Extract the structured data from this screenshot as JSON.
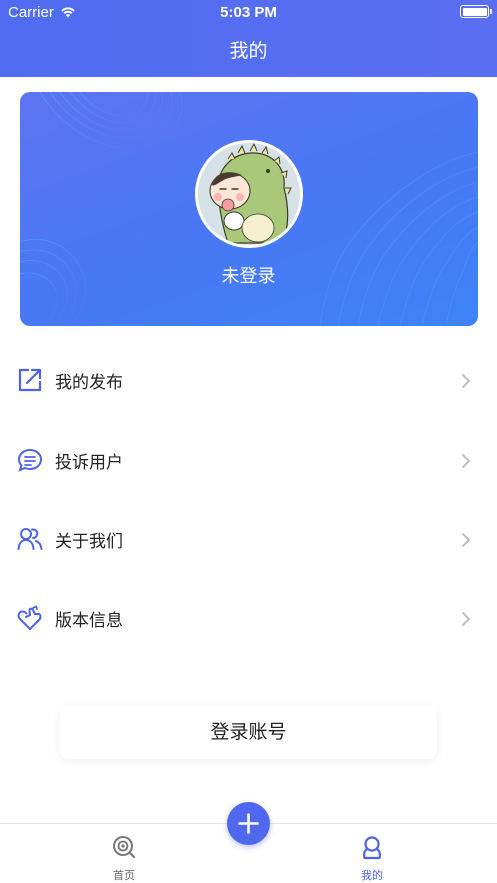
{
  "status_bar": {
    "carrier": "Carrier",
    "time": "5:03 PM"
  },
  "header": {
    "title": "我的"
  },
  "profile": {
    "login_status": "未登录",
    "avatar": "dinosaur-costume-avatar"
  },
  "menu": [
    {
      "label": "我的发布",
      "icon": "share-external-icon"
    },
    {
      "label": "投诉用户",
      "icon": "chat-bubble-icon"
    },
    {
      "label": "关于我们",
      "icon": "users-icon"
    },
    {
      "label": "版本信息",
      "icon": "heart-hand-icon"
    }
  ],
  "login_button": {
    "label": "登录账号"
  },
  "tabbar": {
    "home": {
      "label": "首页",
      "icon": "eye-search-icon"
    },
    "add": {
      "icon": "plus-icon"
    },
    "mine": {
      "label": "我的",
      "icon": "person-icon"
    }
  },
  "colors": {
    "primary": "#4f68ee",
    "header": "#5a6ef2",
    "text": "#222222",
    "muted": "#666666"
  }
}
